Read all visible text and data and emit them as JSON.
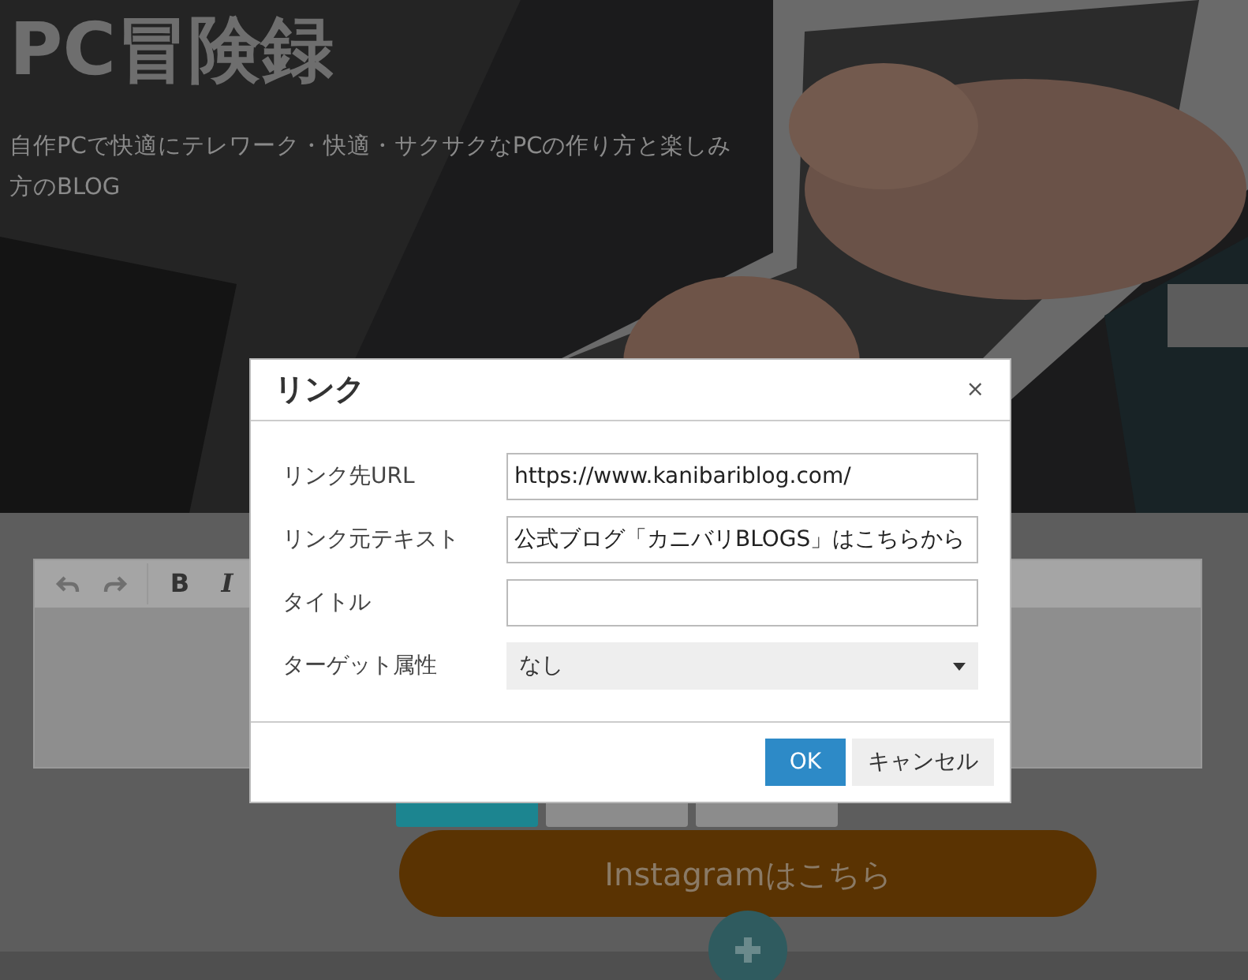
{
  "header": {
    "title": "PC冒険録",
    "tagline": "自作PCで快適にテレワーク・快適・サクサクなPCの作り方と楽しみ方のBLOG"
  },
  "editor": {
    "toolbar": [
      {
        "kind": "undo"
      },
      {
        "kind": "redo"
      },
      {
        "kind": "bold",
        "label": "B"
      },
      {
        "kind": "italic",
        "label": "I"
      }
    ]
  },
  "editor_buttons": [
    {
      "kind": "primary"
    },
    {
      "kind": "secondary"
    },
    {
      "kind": "secondary"
    }
  ],
  "instagram_button": {
    "label": "Instagramはこちら"
  },
  "dialog": {
    "title": "リンク",
    "close": "×",
    "fields": [
      {
        "label": "リンク先URL",
        "kind": "text",
        "value": "https://www.kanibariblog.com/"
      },
      {
        "label": "リンク元テキスト",
        "kind": "text",
        "value": "公式ブログ「カニバリBLOGS」はこちらから"
      },
      {
        "label": "タイトル",
        "kind": "text"
      },
      {
        "label": "ターゲット属性",
        "kind": "select",
        "value": "なし"
      }
    ],
    "buttons": [
      {
        "label": "OK",
        "kind": "primary"
      },
      {
        "label": "キャンセル",
        "kind": "secondary"
      }
    ]
  }
}
